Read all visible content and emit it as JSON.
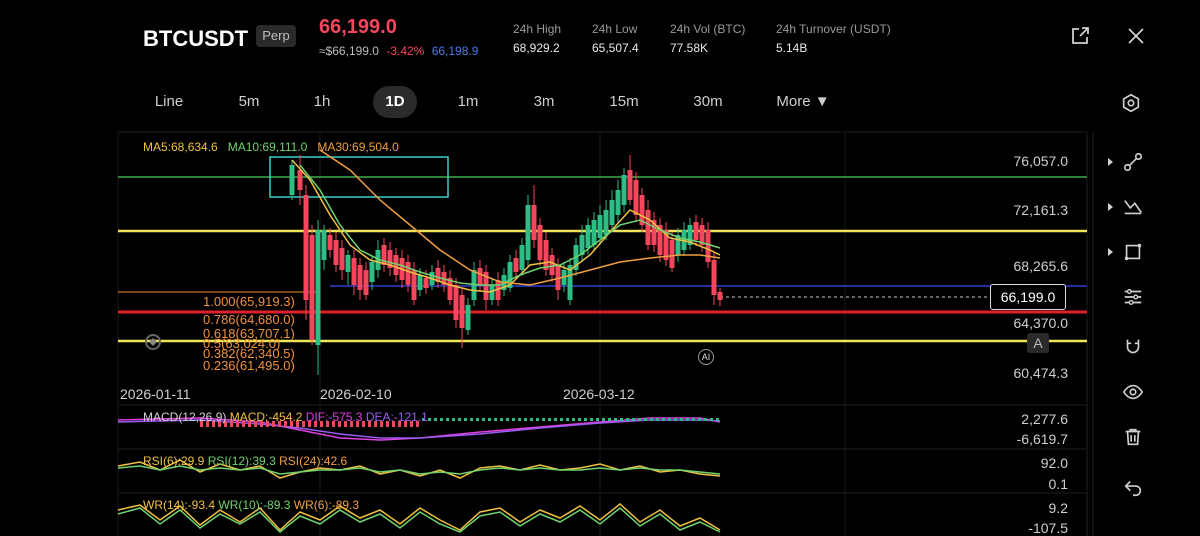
{
  "header": {
    "symbol": "BTCUSDT",
    "badge": "Perp",
    "last_price": "66,199.0",
    "usd_price": "≈$66,199.0",
    "change_pct": "-3.42%",
    "mark_price": "66,198.9",
    "stats": [
      {
        "label": "24h  High",
        "value": "68,929.2"
      },
      {
        "label": "24h  Low",
        "value": "65,507.4"
      },
      {
        "label": "24h  Vol (BTC)",
        "value": "77.58K"
      },
      {
        "label": "24h  Turnover (USDT)",
        "value": "5.14B"
      }
    ],
    "icons": [
      "share-icon",
      "close-icon"
    ]
  },
  "toolbar": {
    "timeframes": [
      "Line",
      "5m",
      "1h",
      "1D",
      "1m",
      "3m",
      "15m",
      "30m"
    ],
    "active": "1D",
    "more_label": "More ▼",
    "settings_icon": "hexagon-settings-icon"
  },
  "main_chart": {
    "legend": {
      "ma5": "MA5:68,634.6",
      "ma10": "MA10:69,111.0",
      "ma30": "MA30:69,504.0"
    },
    "y_labels": [
      "76,057.0",
      "72,161.3",
      "68,265.6",
      "64,370.0",
      "60,474.3"
    ],
    "x_labels": [
      "2026-01-11",
      "2026-02-10",
      "2026-03-12"
    ],
    "current_price_tag": "66,199.0",
    "fib_levels": [
      "1.000(65,919.3)",
      "0.786(64,680.0)",
      "0.618(63,707.1)",
      "0.5(63,024.0)",
      "0.382(62,340.5)",
      "0.236(61,495.0)"
    ],
    "ai_badge": "AI",
    "auto_badge": "A",
    "colors": {
      "up": "#2ebd85",
      "down": "#f6465d",
      "ma5": "#f0c040",
      "ma10": "#6fd36f",
      "ma30": "#f0a040"
    }
  },
  "macd": {
    "legend": {
      "title": "MACD(12,26,9)",
      "macd": "MACD:-454.2",
      "dif": "DIF:-575.3",
      "dea": "DEA:-121.1"
    },
    "y_labels": [
      "2,277.6",
      "-6,619.7"
    ]
  },
  "rsi": {
    "legend": {
      "r6": "RSI(6):29.9",
      "r12": "RSI(12):39.3",
      "r24": "RSI(24):42.6"
    },
    "y_labels": [
      "92.0",
      "0.1"
    ]
  },
  "wr": {
    "legend": {
      "w14": "WR(14):-93.4",
      "w10": "WR(10):-89.3",
      "w6": "WR(6):-89.3"
    },
    "y_labels": [
      "9.2",
      "-107.5"
    ]
  },
  "drawing_tools": [
    "line-tool-icon",
    "trend-tool-icon",
    "shape-tool-icon",
    "fib-tool-icon",
    "magnet-tool-icon",
    "eye-icon",
    "trash-icon",
    "undo-icon"
  ]
}
